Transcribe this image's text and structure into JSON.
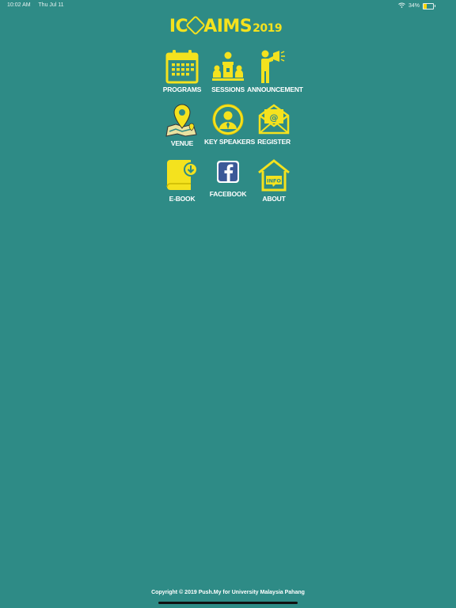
{
  "status_bar": {
    "time": "10:02 AM",
    "date": "Thu Jul 11",
    "battery": "34%",
    "icons": [
      "wifi-icon",
      "battery-icon"
    ]
  },
  "logo": {
    "text_left": "IC",
    "text_right": "AIMS",
    "year": "2019"
  },
  "menu": [
    {
      "label": "PROGRAMS",
      "icon": "calendar-icon"
    },
    {
      "label": "SESSIONS",
      "icon": "conference-icon"
    },
    {
      "label": "ANNOUNCEMENT",
      "icon": "megaphone-person-icon"
    },
    {
      "label": "VENUE",
      "icon": "map-pin-icon"
    },
    {
      "label": "KEY SPEAKERS",
      "icon": "speaker-avatar-icon"
    },
    {
      "label": "REGISTER",
      "icon": "envelope-at-icon"
    },
    {
      "label": "E-BOOK",
      "icon": "ebook-download-icon"
    },
    {
      "label": "FACEBOOK",
      "icon": "facebook-icon"
    },
    {
      "label": "ABOUT",
      "icon": "info-house-icon"
    }
  ],
  "footer": {
    "copyright": "Copyright © 2019 Push.My for University Malaysia Pahang"
  },
  "colors": {
    "background": "#2e8b86",
    "accent": "#f4e21e",
    "facebook": "#3b5998"
  }
}
